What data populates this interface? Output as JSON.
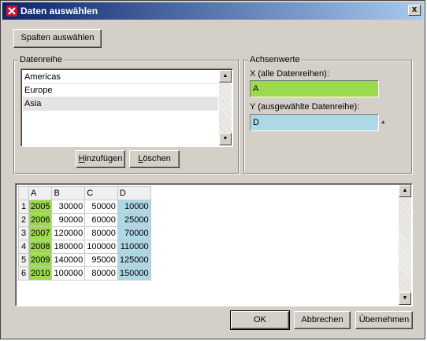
{
  "window": {
    "title": "Daten auswählen",
    "close_label": "x"
  },
  "toolbar": {
    "select_columns_label": "Spalten auswählen"
  },
  "series_group": {
    "label": "Datenreihe",
    "items": [
      "Americas",
      "Europe",
      "Asia"
    ],
    "selected": "Asia",
    "add_prefix": "",
    "add_accel": "H",
    "add_rest": "inzufügen",
    "delete_prefix": "",
    "delete_accel": "L",
    "delete_rest": "öschen"
  },
  "axis_group": {
    "label": "Achsenwerte",
    "x_label": "X (alle Datenreihen):",
    "x_value": "A",
    "x_color": "#9bd94e",
    "y_label": "Y (ausgewählte Datenreihe):",
    "y_value": "D",
    "y_color": "#add8e6",
    "asterisk": "*"
  },
  "grid": {
    "headers": [
      "A",
      "B",
      "C",
      "D"
    ],
    "rows": [
      {
        "n": "1",
        "a": "2005",
        "b": "30000",
        "c": "50000",
        "d": "10000"
      },
      {
        "n": "2",
        "a": "2006",
        "b": "90000",
        "c": "60000",
        "d": "25000"
      },
      {
        "n": "3",
        "a": "2007",
        "b": "120000",
        "c": "80000",
        "d": "70000"
      },
      {
        "n": "4",
        "a": "2008",
        "b": "180000",
        "c": "100000",
        "d": "110000"
      },
      {
        "n": "5",
        "a": "2009",
        "b": "140000",
        "c": "95000",
        "d": "125000"
      },
      {
        "n": "6",
        "a": "2010",
        "b": "100000",
        "c": "80000",
        "d": "150000"
      }
    ]
  },
  "footer": {
    "ok_label": "OK",
    "cancel_label": "Abbrechen",
    "apply_label": "Übernehmen"
  }
}
